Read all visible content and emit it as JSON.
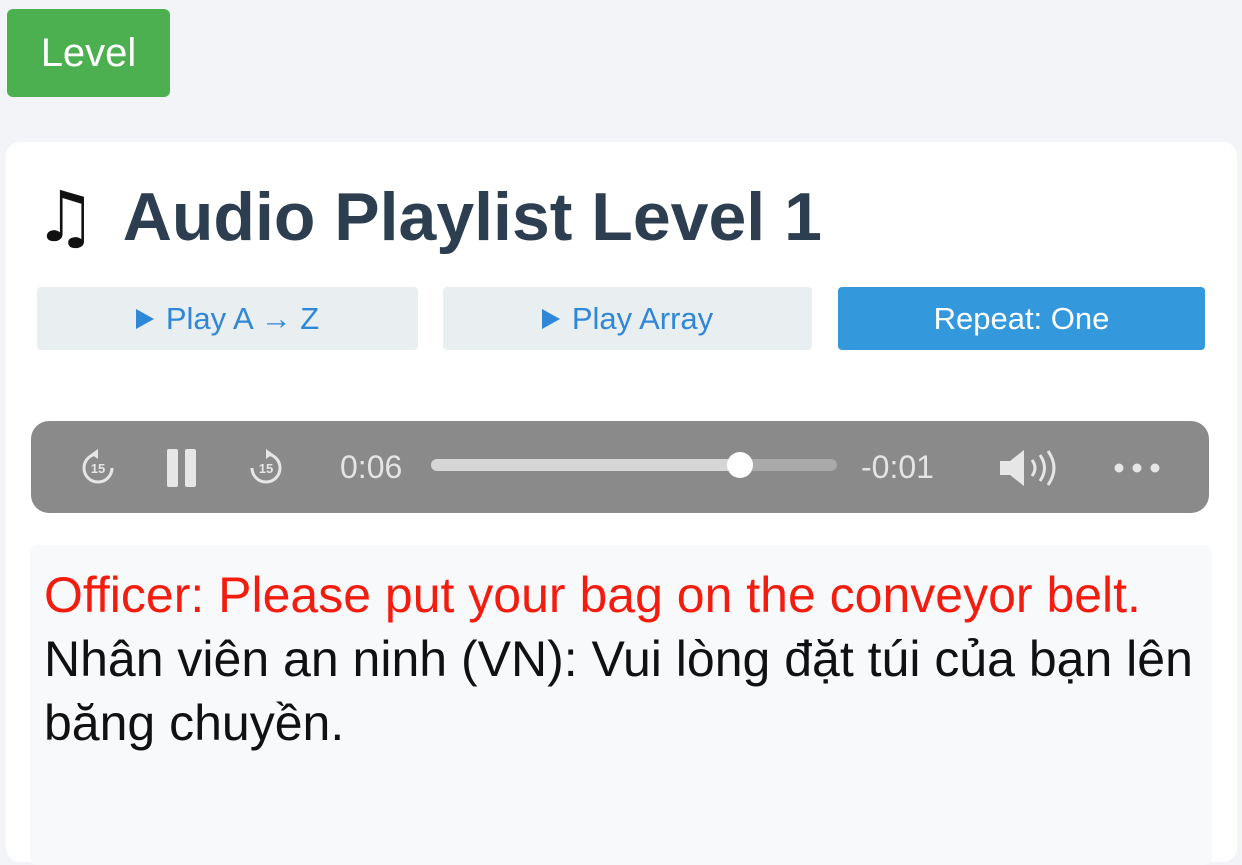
{
  "level_button": {
    "label": "Level",
    "color": "#4caf50"
  },
  "header": {
    "icon": "music-note-icon",
    "glyph": "♫",
    "title": "Audio Playlist Level 1",
    "title_color": "#2c3e50"
  },
  "controls": {
    "play_az": "Play A → Z",
    "play_array": "Play Array",
    "repeat": "Repeat: One",
    "active_color": "#3398dc"
  },
  "player": {
    "elapsed": "0:06",
    "remaining": "-0:01",
    "progress": 0.76,
    "state": "playing",
    "skip_seconds": "15",
    "icons": [
      "skip-back-15-icon",
      "pause-icon",
      "skip-forward-15-icon",
      "volume-icon",
      "more-options-icon"
    ]
  },
  "transcript": {
    "english": "Officer: Please put your bag on the conveyor belt.",
    "vietnamese": "Nhân viên an ninh (VN): Vui lòng đặt túi của bạn lên băng chuyền.",
    "english_color": "#f21d0e"
  }
}
